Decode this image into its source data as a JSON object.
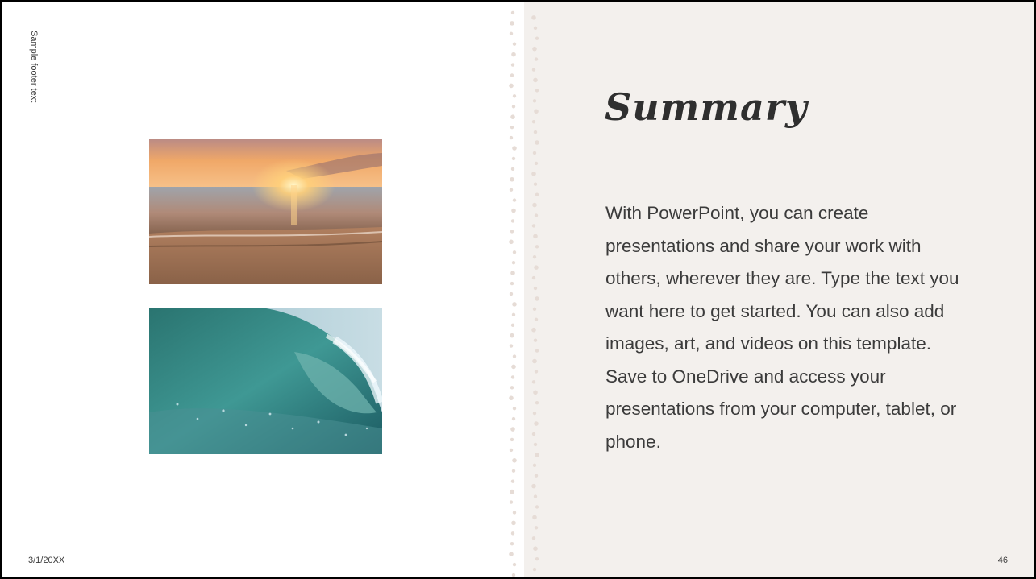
{
  "slide": {
    "footer_text": "Sample footer text",
    "date": "3/1/20XX",
    "page_number": "46",
    "title": "Summary",
    "body": "With PowerPoint, you can create presentations and share your work with others, wherever they are. Type the text you want here to get started. You can also add images, art, and videos on this template. Save to OneDrive and access your presentations from your computer, tablet, or phone."
  },
  "images": [
    {
      "name": "sunset-beach-photo",
      "subject": "sunset over the beach"
    },
    {
      "name": "ocean-wave-photo",
      "subject": "curling ocean wave"
    }
  ],
  "colors": {
    "right_panel": "#f3f0ed",
    "dots": "#e6dcd6",
    "text": "#3b3b3b"
  }
}
